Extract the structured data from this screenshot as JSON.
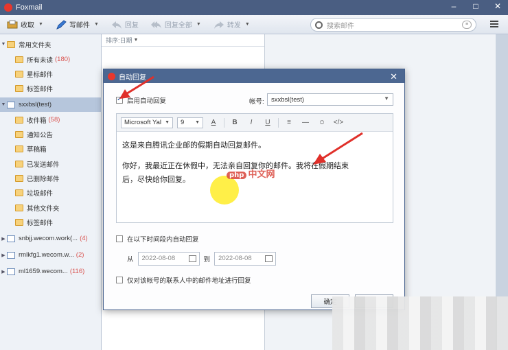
{
  "app": {
    "title": "Foxmail"
  },
  "toolbar": {
    "receive": "收取",
    "compose": "写邮件",
    "reply": "回复",
    "reply_all": "回复全部",
    "forward": "转发",
    "search_placeholder": "搜索邮件"
  },
  "sidebar": {
    "common_group": "常用文件夹",
    "common_items": [
      {
        "label": "所有未读",
        "count": "(180)"
      },
      {
        "label": "星标邮件"
      },
      {
        "label": "标签邮件"
      }
    ],
    "account": "sxxbsl(test)",
    "account_items": [
      {
        "label": "收件箱",
        "count": "(58)"
      },
      {
        "label": "通知公告"
      },
      {
        "label": "草稿箱"
      },
      {
        "label": "已发送邮件"
      },
      {
        "label": "已删除邮件"
      },
      {
        "label": "垃圾邮件"
      },
      {
        "label": "其他文件夹"
      },
      {
        "label": "标签邮件"
      }
    ],
    "other_accounts": [
      {
        "label": "snbjj.wecom.work(...",
        "count": "(4)"
      },
      {
        "label": "rmlkfg1.wecom.w...",
        "count": "(2)"
      },
      {
        "label": "ml1659.wecom...",
        "count": "(116)"
      }
    ]
  },
  "list": {
    "sort_label": "排序:日期"
  },
  "dialog": {
    "title": "自动回复",
    "enable_label": "启用自动回复",
    "enable_checked": true,
    "account_label": "帐号:",
    "account_value": "sxxbsl(test)",
    "font_name": "Microsoft Yal",
    "font_size": "9",
    "body_line1": "这是来自腾讯企业邮的假期自动回复邮件。",
    "body_line2": "你好，我最近正在休假中，无法亲自回复你的邮件。我将在假期结束",
    "body_line3": "后，尽快给你回复。",
    "time_label": "在以下时间段内自动回复",
    "from_label": "从",
    "from_date": "2022-08-08",
    "to_label": "到",
    "to_date": "2022-08-08",
    "only_contacts_label": "仅对该帐号的联系人中的邮件地址进行回复",
    "ok_label": "确定"
  },
  "watermark": {
    "php": "php",
    "text": "中文网"
  },
  "colors": {
    "accent": "#4c6791",
    "arrow": "#e0302a",
    "brand": "#e8372c"
  }
}
